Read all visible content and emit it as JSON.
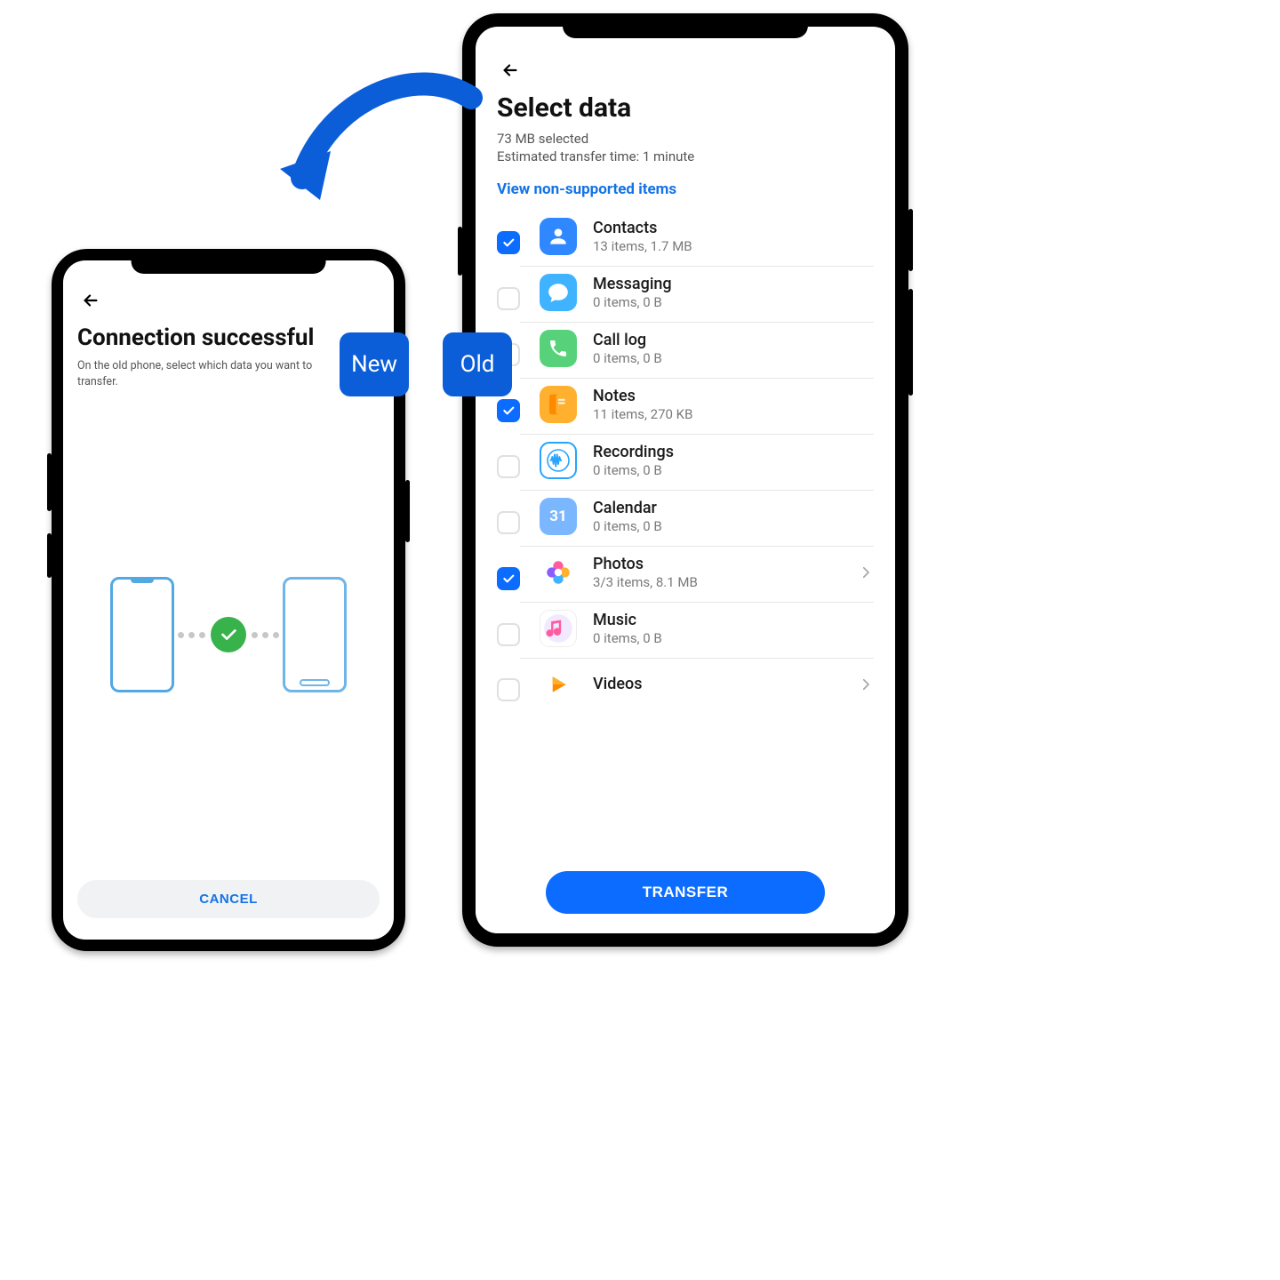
{
  "arrow_color": "#0b5ed7",
  "labels": {
    "new": "New",
    "old": "Old"
  },
  "left_phone": {
    "title": "Connection successful",
    "subtitle": "On the old phone, select which data you want to transfer.",
    "cancel": "CANCEL"
  },
  "right_phone": {
    "title": "Select data",
    "selected_line": "73 MB selected",
    "eta_line": "Estimated transfer time: 1 minute",
    "link": "View non-supported items",
    "transfer": "TRANSFER",
    "calendar_day": "31",
    "items": [
      {
        "id": "contacts",
        "title": "Contacts",
        "sub": "13 items, 1.7 MB",
        "checked": true,
        "chevron": false
      },
      {
        "id": "messaging",
        "title": "Messaging",
        "sub": "0 items, 0 B",
        "checked": false,
        "chevron": false
      },
      {
        "id": "calllog",
        "title": "Call log",
        "sub": "0 items, 0 B",
        "checked": false,
        "chevron": false
      },
      {
        "id": "notes",
        "title": "Notes",
        "sub": "11 items, 270 KB",
        "checked": true,
        "chevron": false
      },
      {
        "id": "recordings",
        "title": "Recordings",
        "sub": "0 items, 0 B",
        "checked": false,
        "chevron": false
      },
      {
        "id": "calendar",
        "title": "Calendar",
        "sub": "0 items, 0 B",
        "checked": false,
        "chevron": false
      },
      {
        "id": "photos",
        "title": "Photos",
        "sub": "3/3 items, 8.1 MB",
        "checked": true,
        "chevron": true
      },
      {
        "id": "music",
        "title": "Music",
        "sub": "0 items, 0 B",
        "checked": false,
        "chevron": false
      },
      {
        "id": "videos",
        "title": "Videos",
        "sub": "",
        "checked": false,
        "chevron": true
      }
    ]
  }
}
